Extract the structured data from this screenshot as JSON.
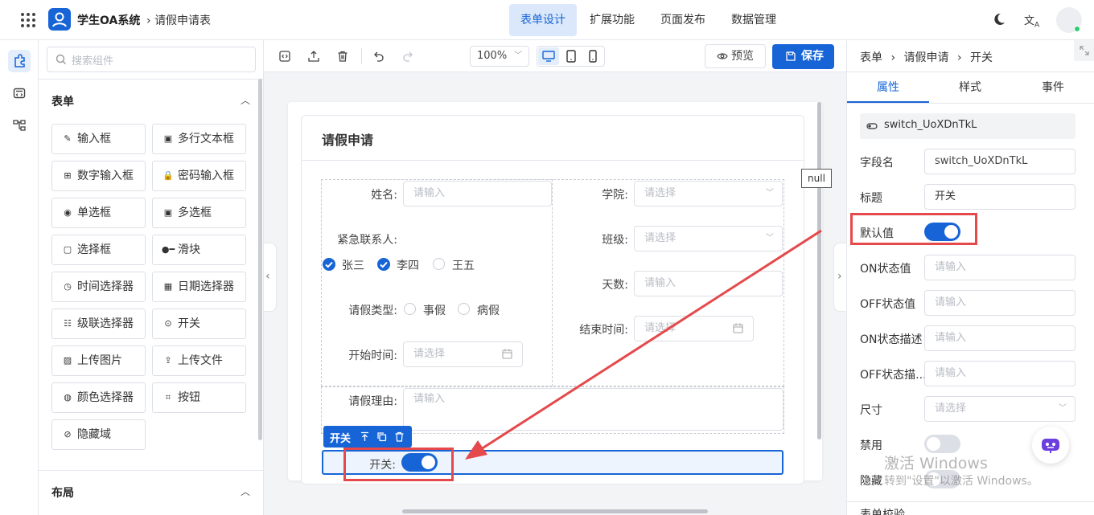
{
  "header": {
    "app_name": "学生OA系统",
    "breadcrumb": "请假申请表",
    "tabs": [
      {
        "label": "表单设计",
        "active": true
      },
      {
        "label": "扩展功能",
        "active": false
      },
      {
        "label": "页面发布",
        "active": false
      },
      {
        "label": "数据管理",
        "active": false
      }
    ]
  },
  "components": {
    "search_placeholder": "搜索组件",
    "group_form": "表单",
    "items": [
      "输入框",
      "多行文本框",
      "数字输入框",
      "密码输入框",
      "单选框",
      "多选框",
      "选择框",
      "滑块",
      "时间选择器",
      "日期选择器",
      "级联选择器",
      "开关",
      "上传图片",
      "上传文件",
      "颜色选择器",
      "按钮",
      "隐藏域"
    ],
    "group_layout": "布局"
  },
  "toolbar": {
    "zoom": "100%",
    "preview_label": "预览",
    "save_label": "保存"
  },
  "form": {
    "title": "请假申请",
    "fields": {
      "name_label": "姓名:",
      "name_placeholder": "请输入",
      "college_label": "学院:",
      "college_placeholder": "请选择",
      "contact_label": "紧急联系人:",
      "contacts": [
        {
          "label": "张三",
          "checked": true
        },
        {
          "label": "李四",
          "checked": true
        },
        {
          "label": "王五",
          "checked": false
        }
      ],
      "class_label": "班级:",
      "class_placeholder": "请选择",
      "days_label": "天数:",
      "days_placeholder": "请输入",
      "type_label": "请假类型:",
      "types": [
        "事假",
        "病假"
      ],
      "end_label": "结束时间:",
      "end_placeholder": "请选择",
      "start_label": "开始时间:",
      "start_placeholder": "请选择",
      "reason_label": "请假理由:",
      "reason_placeholder": "请输入",
      "switch_label": "开关:",
      "switch_value": true
    },
    "selected_tag": "开关",
    "null_tooltip": "null"
  },
  "props": {
    "breadcrumb": [
      "表单",
      "请假申请",
      "开关"
    ],
    "tabs": [
      {
        "label": "属性",
        "active": true
      },
      {
        "label": "样式",
        "active": false
      },
      {
        "label": "事件",
        "active": false
      }
    ],
    "component_id": "switch_UoXDnTkL",
    "field_name_label": "字段名",
    "field_name_value": "switch_UoXDnTkL",
    "title_label": "标题",
    "title_value": "开关",
    "default_label": "默认值",
    "default_value": true,
    "on_value_label": "ON状态值",
    "off_value_label": "OFF状态值",
    "on_desc_label": "ON状态描述",
    "off_desc_label": "OFF状态描...",
    "input_placeholder": "请输入",
    "size_label": "尺寸",
    "size_placeholder": "请选择",
    "disabled_label": "禁用",
    "disabled_value": false,
    "hidden_label": "隐藏",
    "hidden_value": false,
    "validation_label": "表单校验"
  },
  "watermark": {
    "line1": "激活 Windows",
    "line2": "转到\"设置\"以激活 Windows。"
  },
  "colors": {
    "accent": "#1664d6",
    "highlight": "#e5494c"
  }
}
